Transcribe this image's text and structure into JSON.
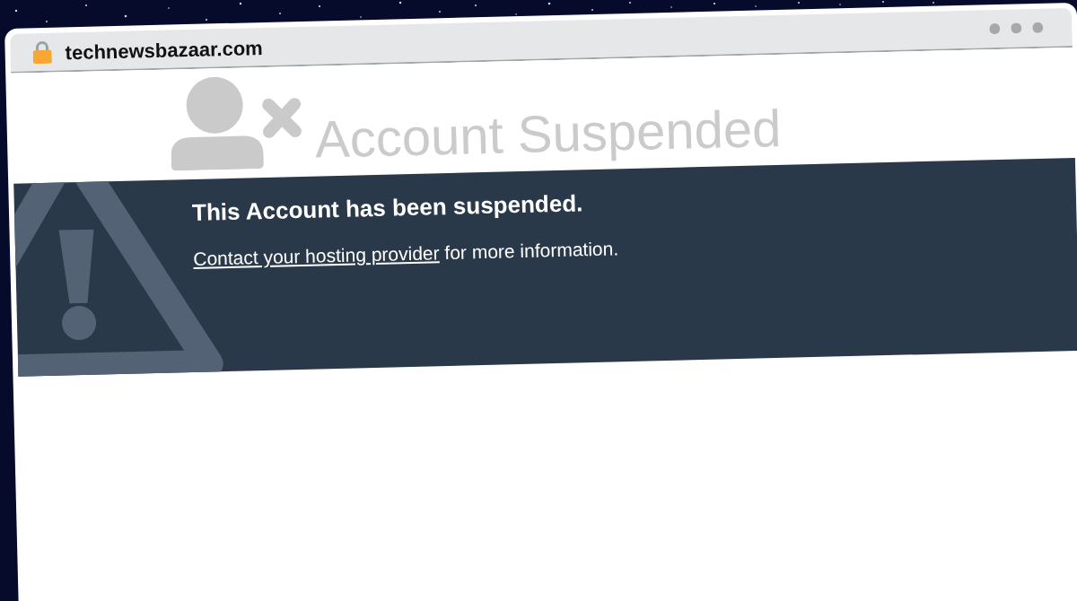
{
  "browser": {
    "address": "technewsbazaar.com"
  },
  "page": {
    "title": "Account Suspended",
    "notice": {
      "heading": "This Account has been suspended.",
      "link": "Contact your hosting provider",
      "text": "for more information."
    }
  }
}
